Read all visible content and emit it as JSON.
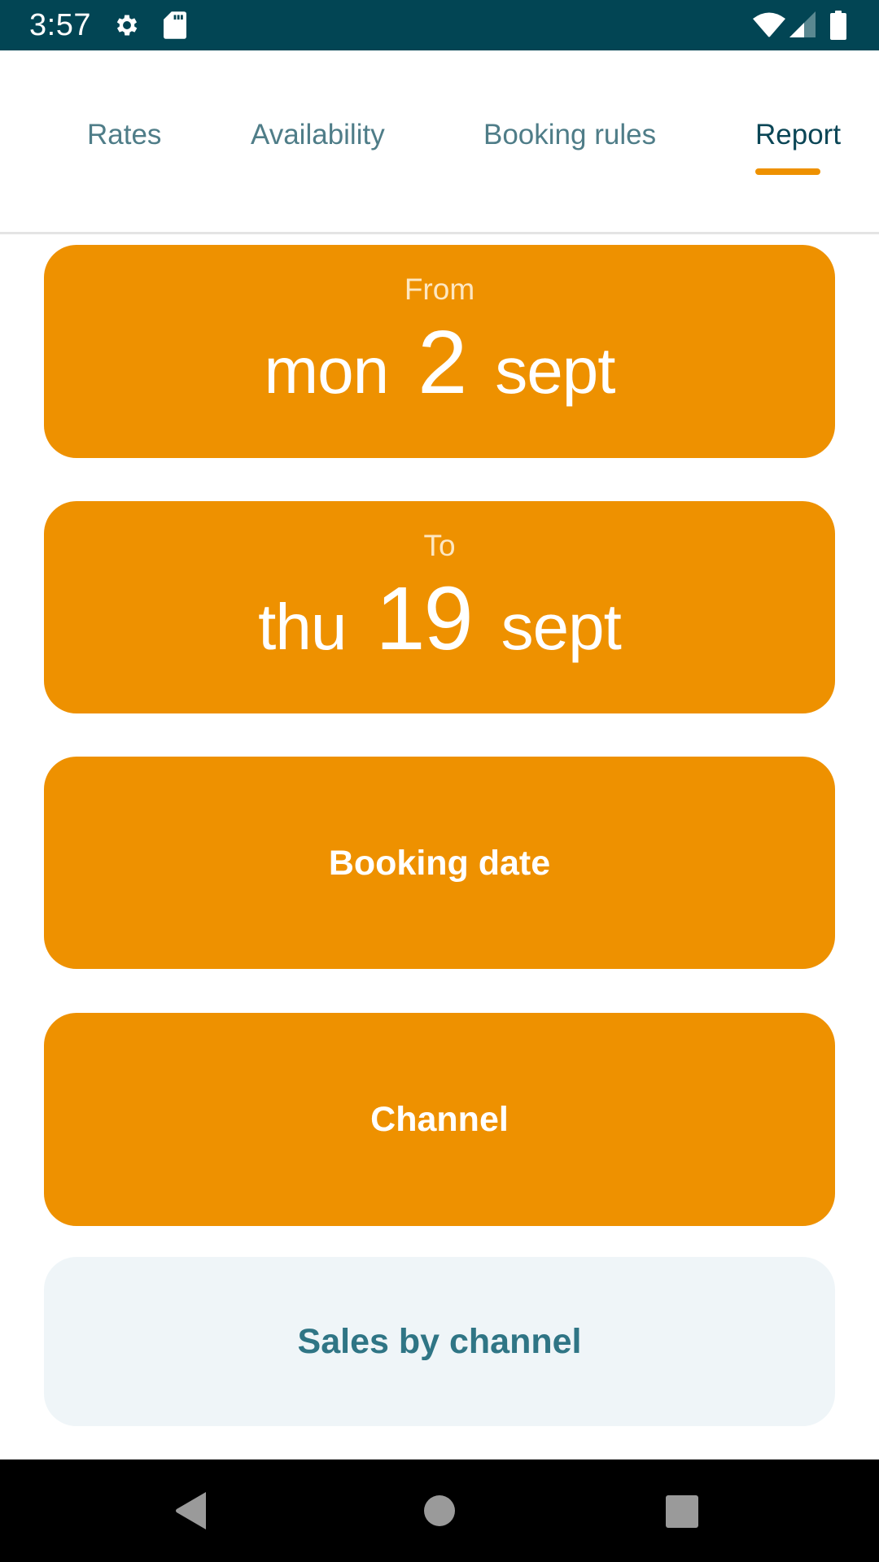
{
  "status_bar": {
    "time": "3:57",
    "left_icons": [
      "gear-icon",
      "sd-card-icon"
    ],
    "right_icons": [
      "wifi-icon",
      "cell-signal-icon",
      "battery-icon"
    ]
  },
  "tabs": [
    {
      "label": "Rates",
      "active": false
    },
    {
      "label": "Availability",
      "active": false
    },
    {
      "label": "Booking rules",
      "active": false
    },
    {
      "label": "Report",
      "active": true
    }
  ],
  "report": {
    "from": {
      "label": "From",
      "weekday": "mon",
      "day": "2",
      "month": "sept"
    },
    "to": {
      "label": "To",
      "weekday": "thu",
      "day": "19",
      "month": "sept"
    },
    "booking_date_label": "Booking date",
    "channel_label": "Channel",
    "sales_by_channel_label": "Sales by channel"
  },
  "nav_bar": {
    "buttons": [
      "back",
      "home",
      "recents"
    ]
  },
  "colors": {
    "status_bar": "#024554",
    "accent_orange": "#EE9100",
    "tab_inactive": "#4F7D88",
    "tab_active": "#0B4656",
    "light_card_bg": "#EFF5F8",
    "light_card_text": "#2F7585"
  }
}
